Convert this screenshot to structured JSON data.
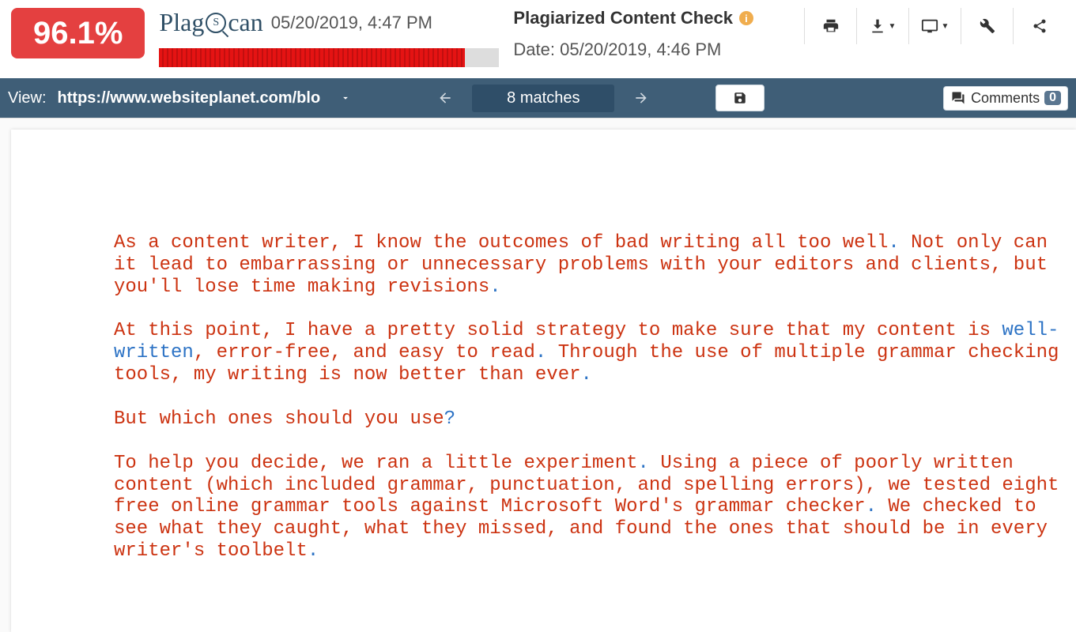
{
  "header": {
    "percentage": "96.1%",
    "logo_prefix": "Plag",
    "logo_mag": "S",
    "logo_suffix": "can",
    "timestamp": "05/20/2019, 4:47 PM",
    "progress_percent": 90,
    "doc_title": "Plagiarized Content Check",
    "date_label": "Date: 05/20/2019, 4:46 PM"
  },
  "toolbar": {
    "view_label": "View:",
    "view_url": "https://www.websiteplanet.com/blo",
    "matches": "8 matches",
    "comments_label": "Comments",
    "comments_count": "0"
  },
  "content": {
    "p1a": "As a content writer, I know the outcomes of bad writing all too well",
    "p1b": " Not only can it lead to embarrassing or unnecessary problems with your editors and clients, but you'll lose time making revisions",
    "p2a": "At this point, I have a pretty solid strategy to make sure that my content is ",
    "p2_well": "well-written",
    "p2b": ", error-free, and easy to read",
    "p2c": " Through the use of multiple grammar checking tools, my writing is now better than ever",
    "p3": "But which ones should you use",
    "p4a": "To help you decide, we ran a little experiment",
    "p4b": " Using a piece of poorly written content (which included grammar, punctuation, and spelling errors), we tested eight free online grammar tools against Microsoft Word's grammar checker",
    "p4c": " We checked to see what they caught, what they missed, and found the ones that should be in every writer's toolbelt"
  }
}
